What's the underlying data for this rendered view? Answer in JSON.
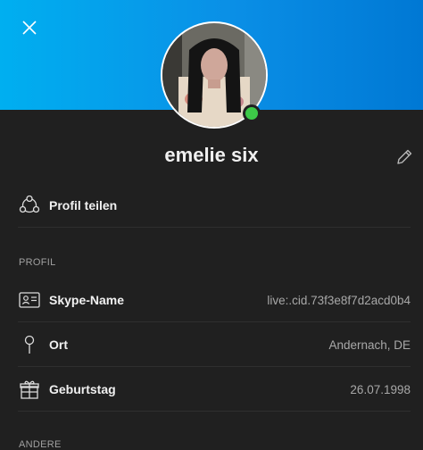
{
  "header": {
    "gradient_start": "#00aff0",
    "gradient_end": "#0078d4",
    "close_icon": "close-icon"
  },
  "profile": {
    "name": "emelie six",
    "status": "online",
    "status_color": "#3dc948"
  },
  "share": {
    "label": "Profil teilen",
    "icon": "share-icon"
  },
  "sections": {
    "profile": "PROFIL",
    "other": "ANDERE"
  },
  "fields": [
    {
      "icon": "id-card-icon",
      "label": "Skype-Name",
      "value": "live:.cid.73f3e8f7d2acd0b4"
    },
    {
      "icon": "location-pin-icon",
      "label": "Ort",
      "value": "Andernach, DE"
    },
    {
      "icon": "gift-icon",
      "label": "Geburtstag",
      "value": "26.07.1998"
    }
  ]
}
